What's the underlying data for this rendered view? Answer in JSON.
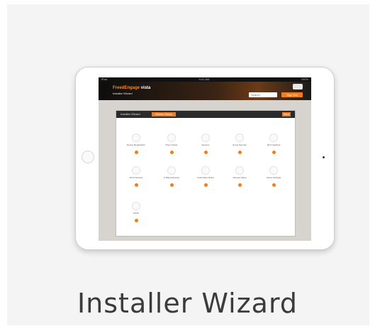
{
  "caption": "Installer Wizard",
  "colors": {
    "accent": "#f07d22",
    "header_dark": "#0d0d0d",
    "card_bg": "#f4f4f4"
  },
  "device": {
    "home_button_icon": "home-button-icon",
    "screen": {
      "status_left": "iPad",
      "status_center": "9:41 AM",
      "status_right": "100%",
      "brand": "FreedEngage",
      "brand_suffix": "vista",
      "subtitle": "Installer Wizard",
      "search_placeholder": "Search",
      "header_button": "Sign Out",
      "panel_title": "Installer Wizard",
      "panel_tab": "Wizard Steps",
      "panel_button": "Next",
      "steps": [
        {
          "label": "Device Registration"
        },
        {
          "label": "Room Setup"
        },
        {
          "label": "Sensors"
        },
        {
          "label": "Home Security"
        },
        {
          "label": "Wi-Fi Settings"
        },
        {
          "label": "Wi-Fi Devices"
        },
        {
          "label": "Z-Wave Devices"
        },
        {
          "label": "Automation Rules"
        },
        {
          "label": "Camera Setup"
        },
        {
          "label": "Scene Settings"
        },
        {
          "label": "Finish"
        }
      ]
    }
  }
}
